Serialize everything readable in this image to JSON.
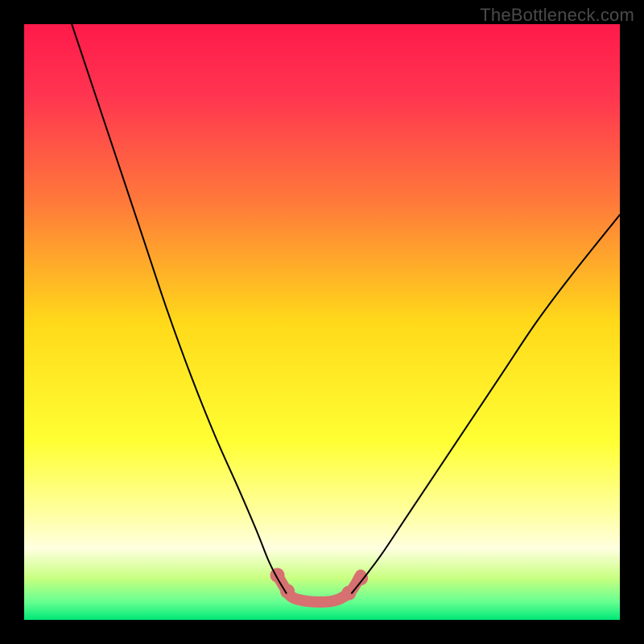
{
  "watermark": "TheBottleneck.com",
  "chart_data": {
    "type": "line",
    "title": "",
    "xlabel": "",
    "ylabel": "",
    "xlim": [
      0,
      100
    ],
    "ylim": [
      0,
      100
    ],
    "background_gradient": {
      "stops": [
        {
          "offset": 0.0,
          "color": "#ff1a4a"
        },
        {
          "offset": 0.12,
          "color": "#ff3550"
        },
        {
          "offset": 0.3,
          "color": "#ff7a3a"
        },
        {
          "offset": 0.5,
          "color": "#ffd91a"
        },
        {
          "offset": 0.7,
          "color": "#ffff33"
        },
        {
          "offset": 0.82,
          "color": "#ffffa0"
        },
        {
          "offset": 0.88,
          "color": "#ffffe0"
        },
        {
          "offset": 0.93,
          "color": "#c8ff80"
        },
        {
          "offset": 0.97,
          "color": "#66ff90"
        },
        {
          "offset": 1.0,
          "color": "#00e878"
        }
      ]
    },
    "series": [
      {
        "name": "bottleneck-curve-left",
        "stroke": "#000000",
        "stroke_width": 2,
        "points": [
          {
            "x": 8,
            "y": 100
          },
          {
            "x": 12,
            "y": 88
          },
          {
            "x": 16,
            "y": 76
          },
          {
            "x": 20,
            "y": 64
          },
          {
            "x": 24,
            "y": 52
          },
          {
            "x": 28,
            "y": 41
          },
          {
            "x": 32,
            "y": 31
          },
          {
            "x": 36,
            "y": 22
          },
          {
            "x": 39,
            "y": 15
          },
          {
            "x": 41,
            "y": 10
          },
          {
            "x": 42.5,
            "y": 7
          },
          {
            "x": 44,
            "y": 4.5
          }
        ]
      },
      {
        "name": "bottleneck-curve-right",
        "stroke": "#000000",
        "stroke_width": 2,
        "points": [
          {
            "x": 55,
            "y": 4.5
          },
          {
            "x": 57,
            "y": 7
          },
          {
            "x": 60,
            "y": 11
          },
          {
            "x": 64,
            "y": 17
          },
          {
            "x": 68,
            "y": 23
          },
          {
            "x": 74,
            "y": 32
          },
          {
            "x": 80,
            "y": 41
          },
          {
            "x": 86,
            "y": 50
          },
          {
            "x": 92,
            "y": 58
          },
          {
            "x": 100,
            "y": 68
          }
        ]
      },
      {
        "name": "optimal-band",
        "stroke": "#d77070",
        "stroke_width": 14,
        "linecap": "round",
        "points": [
          {
            "x": 42.5,
            "y": 7.5
          },
          {
            "x": 44,
            "y": 5
          },
          {
            "x": 45,
            "y": 3.8
          },
          {
            "x": 47,
            "y": 3.2
          },
          {
            "x": 50,
            "y": 3.0
          },
          {
            "x": 52,
            "y": 3.2
          },
          {
            "x": 53.5,
            "y": 3.8
          },
          {
            "x": 55,
            "y": 5
          },
          {
            "x": 56.5,
            "y": 7.5
          }
        ]
      }
    ],
    "markers": [
      {
        "x": 42.5,
        "y": 7.5,
        "color": "#d77070",
        "r": 9
      },
      {
        "x": 44.2,
        "y": 4.8,
        "color": "#d77070",
        "r": 9
      },
      {
        "x": 54.5,
        "y": 4.5,
        "color": "#d77070",
        "r": 9
      },
      {
        "x": 56.5,
        "y": 7.0,
        "color": "#d77070",
        "r": 9
      }
    ]
  }
}
